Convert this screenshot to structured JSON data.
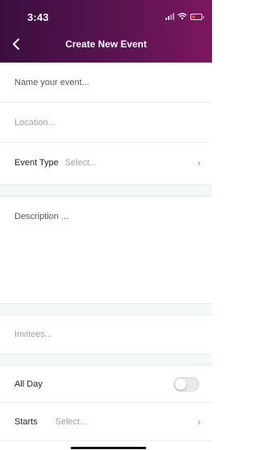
{
  "status_bar": {
    "time": "3:43"
  },
  "nav": {
    "title": "Create New Event"
  },
  "form": {
    "name_placeholder": "Name your event...",
    "location_placeholder": "Location...",
    "event_type_label": "Event Type",
    "event_type_value": "Select...",
    "description_placeholder": "Description ...",
    "invitees_placeholder": "Invitees...",
    "all_day_label": "All Day",
    "all_day_enabled": false,
    "starts_label": "Starts",
    "starts_value": "Select..."
  },
  "colors": {
    "header_start": "#3a0f3f",
    "header_end": "#7d1660",
    "section_bg": "#f3f8f8"
  },
  "icons": [
    "chevron-left-icon",
    "chevron-right-icon",
    "signal-icon",
    "wifi-icon",
    "battery-icon"
  ]
}
